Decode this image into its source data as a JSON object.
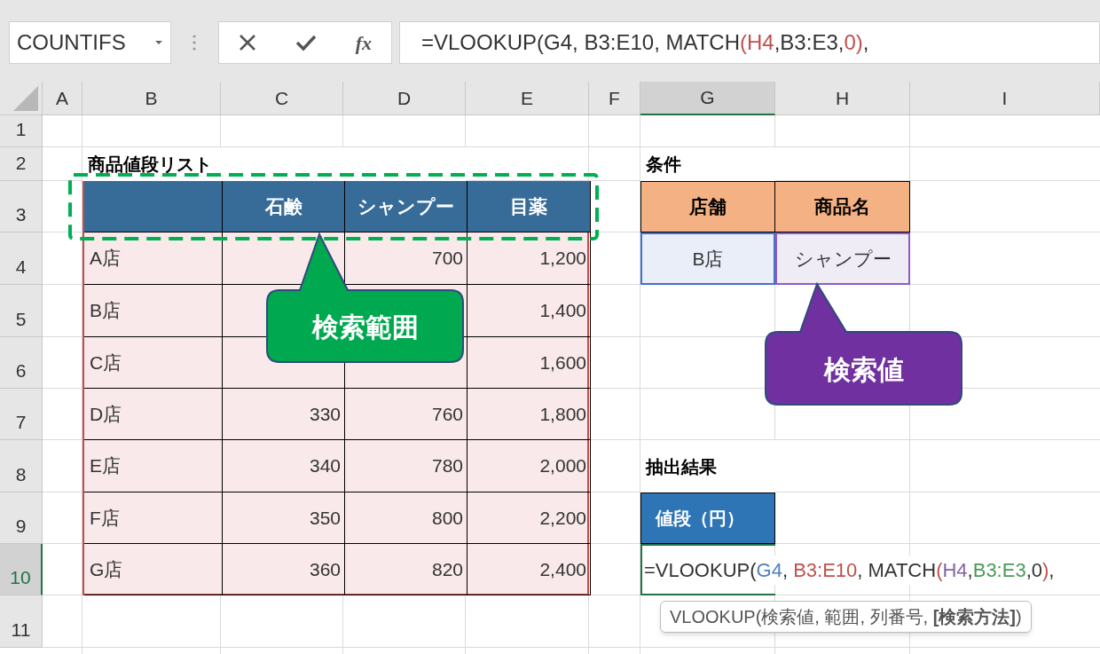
{
  "name_box": {
    "value": "COUNTIFS"
  },
  "formula_bar": {
    "function_label": "fx",
    "segments": [
      {
        "text": "=VLOOKUP(G4, B3:E10, MATCH",
        "color": "#333333"
      },
      {
        "text": "(H4",
        "color": "#c0504d"
      },
      {
        "text": ",B3:E3,",
        "color": "#333333"
      },
      {
        "text": "0)",
        "color": "#c0504d"
      },
      {
        "text": ",",
        "color": "#333333"
      }
    ]
  },
  "columns": [
    {
      "label": "A",
      "selected": false
    },
    {
      "label": "B",
      "selected": false
    },
    {
      "label": "C",
      "selected": false
    },
    {
      "label": "D",
      "selected": false
    },
    {
      "label": "E",
      "selected": false
    },
    {
      "label": "F",
      "selected": false
    },
    {
      "label": "G",
      "selected": true
    },
    {
      "label": "H",
      "selected": false
    },
    {
      "label": "I",
      "selected": false
    }
  ],
  "rows": [
    {
      "label": "1",
      "selected": false
    },
    {
      "label": "2",
      "selected": false
    },
    {
      "label": "3",
      "selected": false
    },
    {
      "label": "4",
      "selected": false
    },
    {
      "label": "5",
      "selected": false
    },
    {
      "label": "6",
      "selected": false
    },
    {
      "label": "7",
      "selected": false
    },
    {
      "label": "8",
      "selected": false
    },
    {
      "label": "9",
      "selected": false
    },
    {
      "label": "10",
      "selected": true
    },
    {
      "label": "11",
      "selected": false
    }
  ],
  "price_table": {
    "title": "商品値段リスト",
    "headers": [
      "石鹸",
      "シャンプー",
      "目薬"
    ],
    "rows": [
      {
        "store": "A店",
        "values": {
          "d": "700",
          "e": "1,200"
        }
      },
      {
        "store": "B店",
        "values": {
          "e": "1,400"
        }
      },
      {
        "store": "C店",
        "values": {
          "e": "1,600"
        }
      },
      {
        "store": "D店",
        "values": {
          "c": "330",
          "d": "760",
          "e": "1,800"
        }
      },
      {
        "store": "E店",
        "values": {
          "c": "340",
          "d": "780",
          "e": "2,000"
        }
      },
      {
        "store": "F店",
        "values": {
          "c": "350",
          "d": "800",
          "e": "2,200"
        }
      },
      {
        "store": "G店",
        "values": {
          "c": "360",
          "d": "820",
          "e": "2,400"
        }
      }
    ]
  },
  "conditions": {
    "title": "条件",
    "headers": [
      "店舗",
      "商品名"
    ],
    "values": [
      {
        "text": "B店",
        "color": "#4472c4"
      },
      {
        "text": "シャンプー",
        "color": "#8e5cc2"
      }
    ]
  },
  "result": {
    "title": "抽出結果",
    "header": "値段（円）",
    "segments": [
      {
        "text": "=VLOOKUP(",
        "color": "#333333"
      },
      {
        "text": "G4",
        "color": "#4f81bd"
      },
      {
        "text": ", ",
        "color": "#333333"
      },
      {
        "text": "B3:E10",
        "color": "#c0504d"
      },
      {
        "text": ", MATCH",
        "color": "#333333"
      },
      {
        "text": "(",
        "color": "#c0504d"
      },
      {
        "text": "H4",
        "color": "#8064a2"
      },
      {
        "text": ",",
        "color": "#333333"
      },
      {
        "text": "B3:E3",
        "color": "#4a9a58"
      },
      {
        "text": ",0",
        "color": "#333333"
      },
      {
        "text": ")",
        "color": "#c0504d"
      },
      {
        "text": ",",
        "color": "#333333"
      }
    ]
  },
  "tooltip": {
    "text": "VLOOKUP(検索値, 範囲, 列番号, **[検索方法]**)"
  },
  "callouts": [
    {
      "text": "検索範囲",
      "color": "#00a84f"
    },
    {
      "text": "検索値",
      "color": "#7030a0"
    }
  ]
}
